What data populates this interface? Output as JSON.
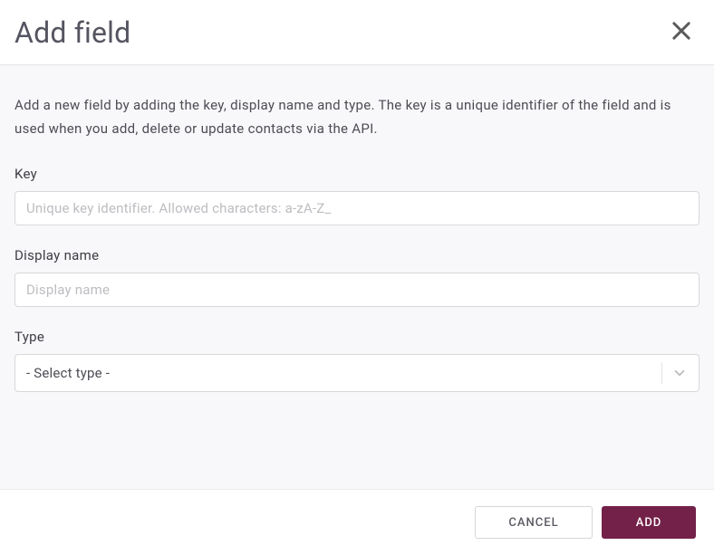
{
  "header": {
    "title": "Add field"
  },
  "body": {
    "description": "Add a new field by adding the key, display name and type. The key is a unique identifier of the field and is used when you add, delete or update contacts via the API.",
    "fields": {
      "key": {
        "label": "Key",
        "placeholder": "Unique key identifier. Allowed characters: a-zA-Z_",
        "value": ""
      },
      "displayName": {
        "label": "Display name",
        "placeholder": "Display name",
        "value": ""
      },
      "type": {
        "label": "Type",
        "selected": "- Select type -"
      }
    }
  },
  "footer": {
    "cancelLabel": "CANCEL",
    "addLabel": "ADD"
  }
}
